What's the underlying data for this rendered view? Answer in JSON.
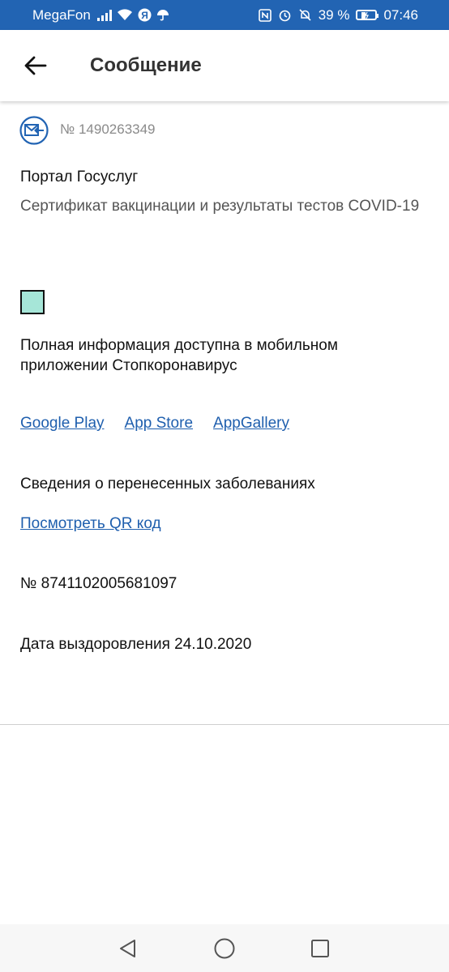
{
  "status_bar": {
    "carrier": "MegaFon",
    "battery": "39 %",
    "time": "07:46",
    "icons": [
      "signal-icon",
      "wifi-icon",
      "yandex-icon",
      "umbrella-icon",
      "nfc-icon",
      "alarm-icon",
      "bell-muted-icon",
      "battery-icon"
    ]
  },
  "app_bar": {
    "title": "Сообщение"
  },
  "message": {
    "number": "№ 1490263349",
    "sender": "Портал Госуслуг",
    "subject": "Сертификат вакцинации и результаты тестов COVID-19",
    "info": "Полная информация доступна в мобильном приложении Стопкоронавирус",
    "stores": [
      "Google Play",
      "App Store",
      "AppGallery"
    ],
    "illness": "Сведения о перенесенных заболеваниях",
    "qr_link": "Посмотреть QR код",
    "cert_number": "№ 8741102005681097",
    "recovery": "Дата выздоровления 24.10.2020"
  },
  "colors": {
    "status_bar": "#2264b3",
    "link": "#1f5fae",
    "qr_box": "#a6e6d8"
  }
}
